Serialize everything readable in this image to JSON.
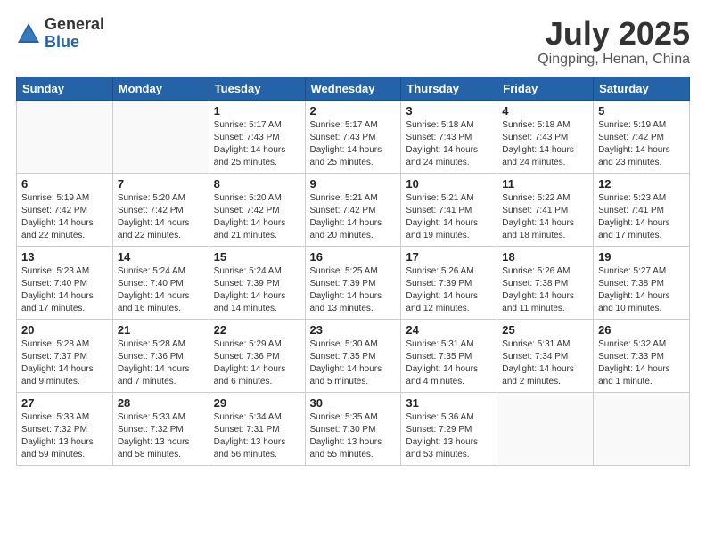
{
  "header": {
    "logo_general": "General",
    "logo_blue": "Blue",
    "month_title": "July 2025",
    "location": "Qingping, Henan, China"
  },
  "weekdays": [
    "Sunday",
    "Monday",
    "Tuesday",
    "Wednesday",
    "Thursday",
    "Friday",
    "Saturday"
  ],
  "weeks": [
    [
      {
        "day": "",
        "info": ""
      },
      {
        "day": "",
        "info": ""
      },
      {
        "day": "1",
        "info": "Sunrise: 5:17 AM\nSunset: 7:43 PM\nDaylight: 14 hours and 25 minutes."
      },
      {
        "day": "2",
        "info": "Sunrise: 5:17 AM\nSunset: 7:43 PM\nDaylight: 14 hours and 25 minutes."
      },
      {
        "day": "3",
        "info": "Sunrise: 5:18 AM\nSunset: 7:43 PM\nDaylight: 14 hours and 24 minutes."
      },
      {
        "day": "4",
        "info": "Sunrise: 5:18 AM\nSunset: 7:43 PM\nDaylight: 14 hours and 24 minutes."
      },
      {
        "day": "5",
        "info": "Sunrise: 5:19 AM\nSunset: 7:42 PM\nDaylight: 14 hours and 23 minutes."
      }
    ],
    [
      {
        "day": "6",
        "info": "Sunrise: 5:19 AM\nSunset: 7:42 PM\nDaylight: 14 hours and 22 minutes."
      },
      {
        "day": "7",
        "info": "Sunrise: 5:20 AM\nSunset: 7:42 PM\nDaylight: 14 hours and 22 minutes."
      },
      {
        "day": "8",
        "info": "Sunrise: 5:20 AM\nSunset: 7:42 PM\nDaylight: 14 hours and 21 minutes."
      },
      {
        "day": "9",
        "info": "Sunrise: 5:21 AM\nSunset: 7:42 PM\nDaylight: 14 hours and 20 minutes."
      },
      {
        "day": "10",
        "info": "Sunrise: 5:21 AM\nSunset: 7:41 PM\nDaylight: 14 hours and 19 minutes."
      },
      {
        "day": "11",
        "info": "Sunrise: 5:22 AM\nSunset: 7:41 PM\nDaylight: 14 hours and 18 minutes."
      },
      {
        "day": "12",
        "info": "Sunrise: 5:23 AM\nSunset: 7:41 PM\nDaylight: 14 hours and 17 minutes."
      }
    ],
    [
      {
        "day": "13",
        "info": "Sunrise: 5:23 AM\nSunset: 7:40 PM\nDaylight: 14 hours and 17 minutes."
      },
      {
        "day": "14",
        "info": "Sunrise: 5:24 AM\nSunset: 7:40 PM\nDaylight: 14 hours and 16 minutes."
      },
      {
        "day": "15",
        "info": "Sunrise: 5:24 AM\nSunset: 7:39 PM\nDaylight: 14 hours and 14 minutes."
      },
      {
        "day": "16",
        "info": "Sunrise: 5:25 AM\nSunset: 7:39 PM\nDaylight: 14 hours and 13 minutes."
      },
      {
        "day": "17",
        "info": "Sunrise: 5:26 AM\nSunset: 7:39 PM\nDaylight: 14 hours and 12 minutes."
      },
      {
        "day": "18",
        "info": "Sunrise: 5:26 AM\nSunset: 7:38 PM\nDaylight: 14 hours and 11 minutes."
      },
      {
        "day": "19",
        "info": "Sunrise: 5:27 AM\nSunset: 7:38 PM\nDaylight: 14 hours and 10 minutes."
      }
    ],
    [
      {
        "day": "20",
        "info": "Sunrise: 5:28 AM\nSunset: 7:37 PM\nDaylight: 14 hours and 9 minutes."
      },
      {
        "day": "21",
        "info": "Sunrise: 5:28 AM\nSunset: 7:36 PM\nDaylight: 14 hours and 7 minutes."
      },
      {
        "day": "22",
        "info": "Sunrise: 5:29 AM\nSunset: 7:36 PM\nDaylight: 14 hours and 6 minutes."
      },
      {
        "day": "23",
        "info": "Sunrise: 5:30 AM\nSunset: 7:35 PM\nDaylight: 14 hours and 5 minutes."
      },
      {
        "day": "24",
        "info": "Sunrise: 5:31 AM\nSunset: 7:35 PM\nDaylight: 14 hours and 4 minutes."
      },
      {
        "day": "25",
        "info": "Sunrise: 5:31 AM\nSunset: 7:34 PM\nDaylight: 14 hours and 2 minutes."
      },
      {
        "day": "26",
        "info": "Sunrise: 5:32 AM\nSunset: 7:33 PM\nDaylight: 14 hours and 1 minute."
      }
    ],
    [
      {
        "day": "27",
        "info": "Sunrise: 5:33 AM\nSunset: 7:32 PM\nDaylight: 13 hours and 59 minutes."
      },
      {
        "day": "28",
        "info": "Sunrise: 5:33 AM\nSunset: 7:32 PM\nDaylight: 13 hours and 58 minutes."
      },
      {
        "day": "29",
        "info": "Sunrise: 5:34 AM\nSunset: 7:31 PM\nDaylight: 13 hours and 56 minutes."
      },
      {
        "day": "30",
        "info": "Sunrise: 5:35 AM\nSunset: 7:30 PM\nDaylight: 13 hours and 55 minutes."
      },
      {
        "day": "31",
        "info": "Sunrise: 5:36 AM\nSunset: 7:29 PM\nDaylight: 13 hours and 53 minutes."
      },
      {
        "day": "",
        "info": ""
      },
      {
        "day": "",
        "info": ""
      }
    ]
  ]
}
